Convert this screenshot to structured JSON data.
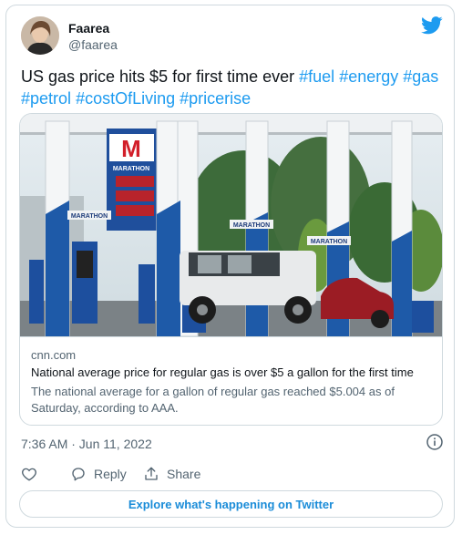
{
  "author": {
    "name": "Faarea",
    "handle": "@faarea"
  },
  "tweet": {
    "text_plain": "US gas price hits $5 for first time ever",
    "hashtags_line1": [
      "#fuel",
      "#energy",
      "#gas"
    ],
    "hashtags_line2": [
      "#petrol",
      "#costOfLiving",
      "#pricerise"
    ]
  },
  "link_card": {
    "domain": "cnn.com",
    "title": "National average price for regular gas is over $5 a gallon for the first time",
    "description": "The national average for a gallon of regular gas reached $5.004 as of Saturday, according to AAA.",
    "photo": {
      "sign_brand": "M",
      "sign_text": "MARATHON",
      "canopy_signs": [
        "MARATHON",
        "MARATHON",
        "MARATHON"
      ]
    }
  },
  "timestamp": "7:36 AM · Jun 11, 2022",
  "actions": {
    "reply_label": "Reply",
    "share_label": "Share"
  },
  "explore_label": "Explore what's happening on Twitter",
  "colors": {
    "accent": "#1d9bf0",
    "pump_blue": "#1e5aa8",
    "marathon_red": "#d21f2a"
  }
}
